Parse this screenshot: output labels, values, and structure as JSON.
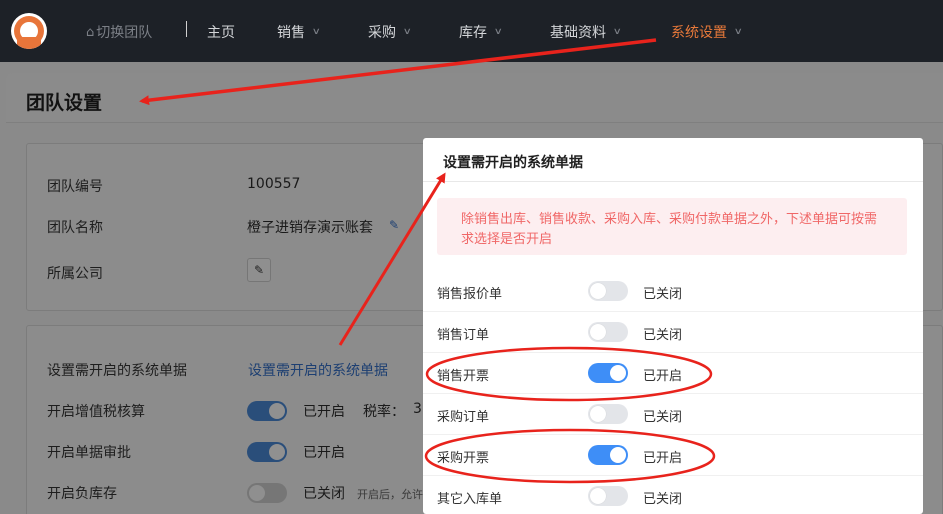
{
  "topbar": {
    "team_switch": "切换团队",
    "nav": [
      {
        "label": "主页"
      },
      {
        "label": "销售"
      },
      {
        "label": "采购"
      },
      {
        "label": "库存"
      },
      {
        "label": "基础资料"
      },
      {
        "label": "系统设置"
      }
    ]
  },
  "page": {
    "title": "团队设置",
    "info": {
      "team_id_label": "团队编号",
      "team_id_value": "100557",
      "team_name_label": "团队名称",
      "team_name_value": "橙子进销存演示账套",
      "company_label": "所属公司"
    },
    "settings": {
      "docs_label": "设置需开启的系统单据",
      "docs_link": "设置需开启的系统单据",
      "vat_label": "开启增值税核算",
      "vat_status": "已开启",
      "tax_rate_label": "税率：",
      "tax_rate_partial": "3",
      "approval_label": "开启单据审批",
      "approval_status": "已开启",
      "negative_label": "开启负库存",
      "negative_status": "已关闭",
      "negative_hint": "开启后，允许"
    }
  },
  "dialog": {
    "title": "设置需开启的系统单据",
    "notice": "除销售出库、销售收款、采购入库、采购付款单据之外，下述单据可按需求选择是否开启",
    "rows": [
      {
        "label": "销售报价单",
        "status": "已关闭",
        "on": false
      },
      {
        "label": "销售订单",
        "status": "已关闭",
        "on": false
      },
      {
        "label": "销售开票",
        "status": "已开启",
        "on": true
      },
      {
        "label": "采购订单",
        "status": "已关闭",
        "on": false
      },
      {
        "label": "采购开票",
        "status": "已开启",
        "on": true
      },
      {
        "label": "其它入库单",
        "status": "已关闭",
        "on": false
      }
    ]
  },
  "colors": {
    "accent": "#e8793a",
    "switch_on": "#3e8ef7",
    "switch_off": "#e3e5e9",
    "notice_text": "#f06767",
    "annotation": "#e8231c"
  }
}
